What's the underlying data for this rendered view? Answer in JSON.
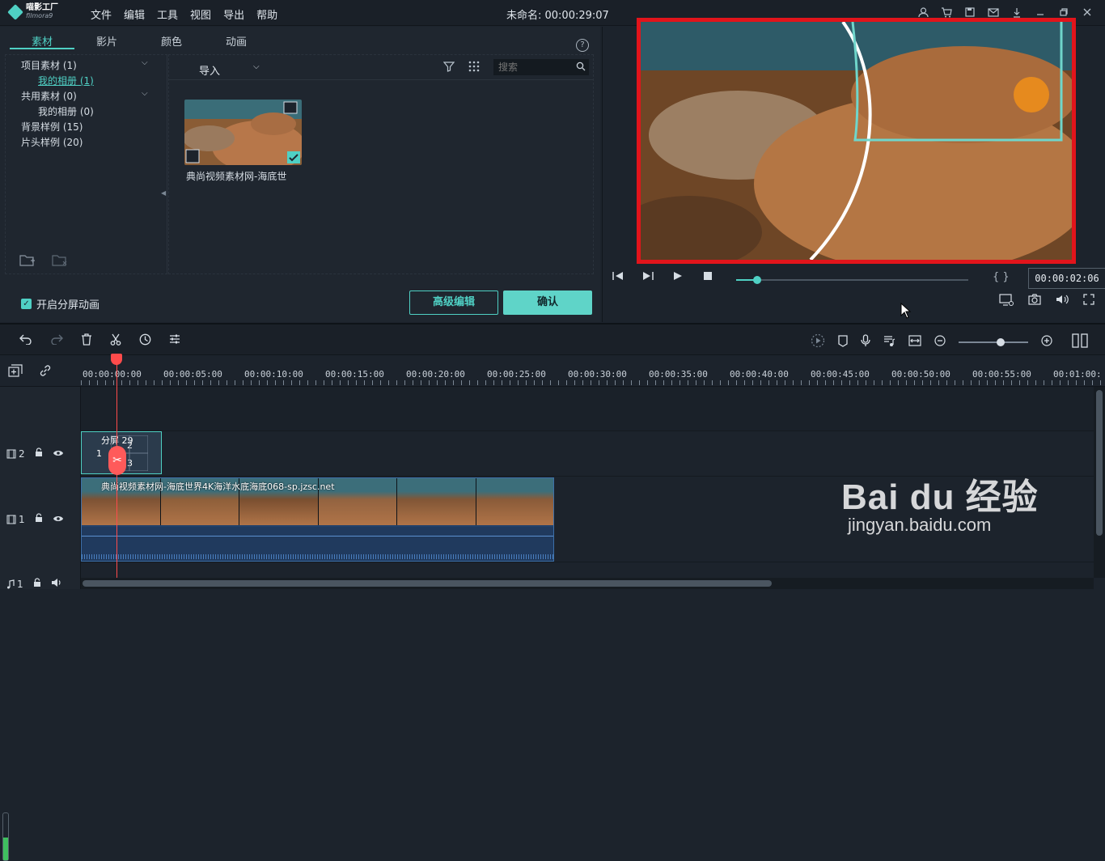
{
  "app": {
    "logo_name": "喵影工厂",
    "logo_sub": "filmora9",
    "window_title": "未命名: 00:00:29:07"
  },
  "menu": [
    "文件",
    "编辑",
    "工具",
    "视图",
    "导出",
    "帮助"
  ],
  "media": {
    "tabs": [
      "素材",
      "影片",
      "颜色",
      "动画"
    ],
    "tree": [
      {
        "label": "项目素材 (1)"
      },
      {
        "label": "我的相册 (1)"
      },
      {
        "label": "共用素材 (0)"
      },
      {
        "label": "我的相册 (0)"
      },
      {
        "label": "背景样例 (15)"
      },
      {
        "label": "片头样例 (20)"
      }
    ],
    "import_label": "导入",
    "search_placeholder": "搜索",
    "thumb_label": "典尚视频素材网-海底世"
  },
  "split": {
    "checkbox_label": "开启分屏动画",
    "advanced_btn": "高级编辑",
    "ok_btn": "确认"
  },
  "preview": {
    "timecode": "00:00:02:06",
    "progress": 0.09
  },
  "timeline": {
    "ticks": [
      "00:00:00:00",
      "00:00:05:00",
      "00:00:10:00",
      "00:00:15:00",
      "00:00:20:00",
      "00:00:25:00",
      "00:00:30:00",
      "00:00:35:00",
      "00:00:40:00",
      "00:00:45:00",
      "00:00:50:00",
      "00:00:55:00",
      "00:01:00:"
    ],
    "track2_label": "2",
    "track1_label": "1",
    "audio_label": "1",
    "split_clip_label": "分屏 29",
    "split_nums": [
      "1",
      "2",
      "3"
    ],
    "video_clip_name": "典尚视频素材网-海底世界4K海洋水底海底068-sp.jzsc.net"
  },
  "watermark": {
    "line1": "Bai du 经验",
    "line2": "jingyan.baidu.com"
  },
  "colors": {
    "accent": "#4fd0c4",
    "highlight": "#e2141b",
    "playhead": "#ff4b4b"
  }
}
